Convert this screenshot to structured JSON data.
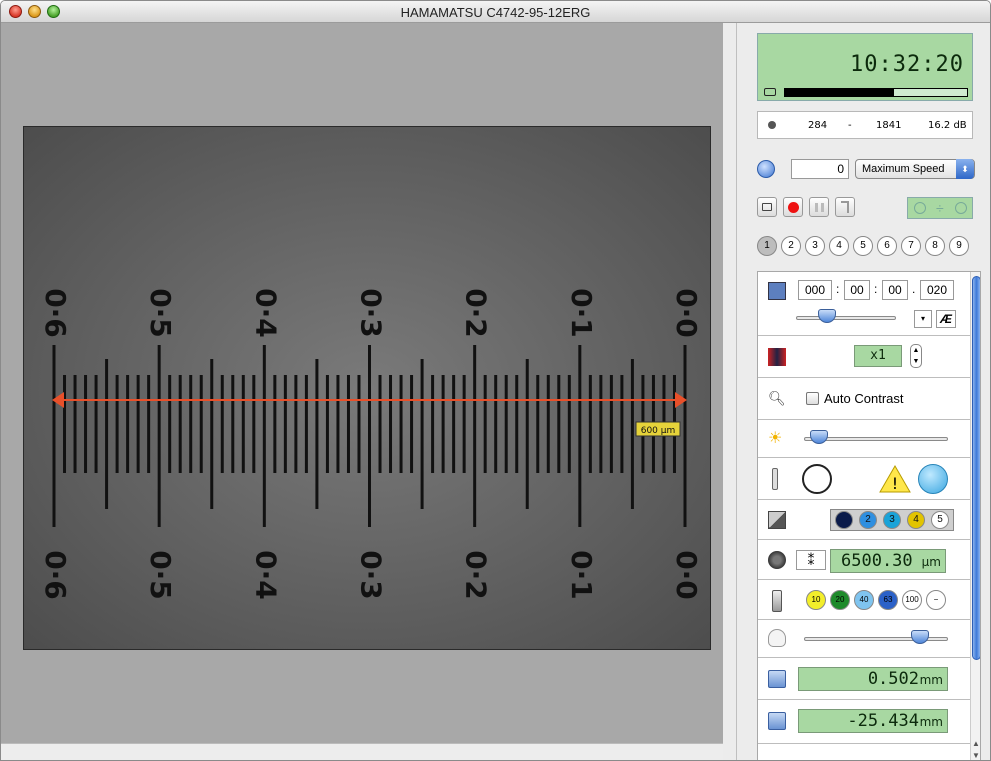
{
  "window": {
    "title": "HAMAMATSU C4742-95-12ERG"
  },
  "status": {
    "time": "10:32:20",
    "progress": 0.6
  },
  "histogram": {
    "min": "284",
    "dash": "-",
    "max": "1841",
    "dynamic_range": "16.2 dB"
  },
  "acquisition": {
    "frame_count": "0",
    "speed": "Maximum Speed"
  },
  "channels": {
    "labels": [
      "1",
      "2",
      "3",
      "4",
      "5",
      "6",
      "7",
      "8",
      "9"
    ],
    "selected": "1"
  },
  "exposure": {
    "h": "000",
    "m": "00",
    "s": "00",
    "ms": "020",
    "sep1": ":",
    "sep2": ":",
    "sep3": ".",
    "ae_label": "Æ"
  },
  "binning": {
    "value": "x1"
  },
  "contrast": {
    "label": "Auto Contrast",
    "checked": false
  },
  "brightness": {
    "level": 0.05
  },
  "filters": {
    "labels": [
      "1",
      "2",
      "3",
      "4",
      "5"
    ]
  },
  "focus": {
    "value": "6500.30",
    "unit": "µm",
    "mode_symbol": "⁑"
  },
  "objectives": {
    "labels": [
      "10",
      "20",
      "40",
      "63",
      "100",
      "−"
    ]
  },
  "lamp": {
    "level": 0.85
  },
  "stage": {
    "x": "0.502",
    "x_unit": "mm",
    "y": "-25.434",
    "y_unit": "mm"
  },
  "image": {
    "top_labels": [
      "0·6",
      "0·5",
      "0·4",
      "0·3",
      "0·2",
      "0·1",
      "0·0"
    ],
    "bottom_labels": [
      "0·6",
      "0·5",
      "0·4",
      "0·3",
      "0·2",
      "0·1",
      "0·0"
    ],
    "measure_label": "600 µm",
    "colors": {
      "measure": "#e8502a",
      "badge": "#e6d33a"
    }
  }
}
